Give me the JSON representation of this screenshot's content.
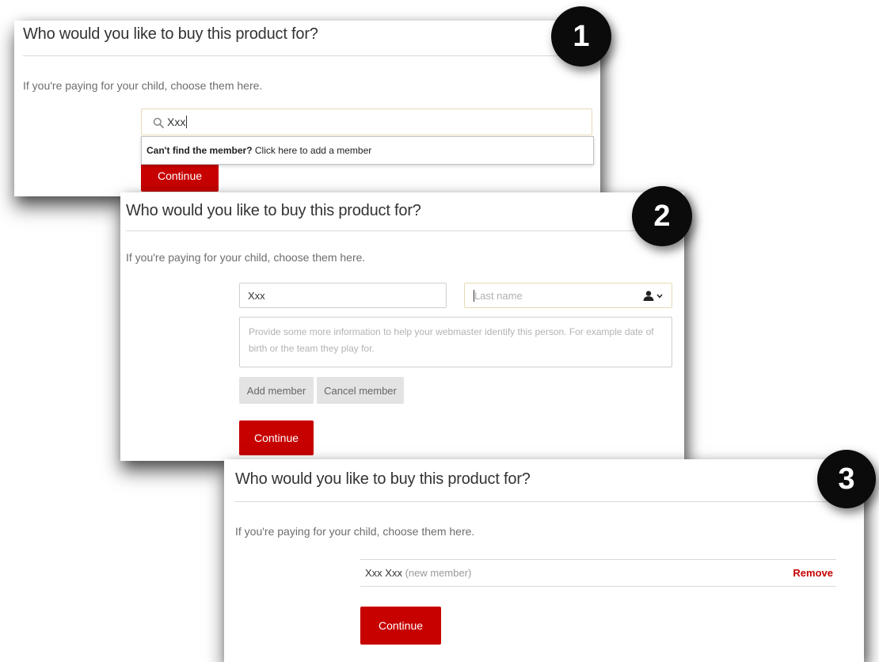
{
  "colors": {
    "accent": "#c70000",
    "badge": "#0b0b0b",
    "divider": "#d9d9d9",
    "muted_text": "#6d6d6d"
  },
  "step1": {
    "badge": "1",
    "title": "Who would you like to buy this product for?",
    "subtitle": "If you're paying for your child, choose them here.",
    "search": {
      "icon": "search-icon",
      "value": "Xxx"
    },
    "dropdown": {
      "bold_text": "Can't find the member?",
      "link_text": " Click here to add a member"
    },
    "continue_label": "Continue"
  },
  "step2": {
    "badge": "2",
    "title": "Who would you like to buy this product for?",
    "subtitle": "If you're paying for your child, choose them here.",
    "first_name_value": "Xxx",
    "last_name_placeholder": "Last name",
    "info_placeholder": "Provide some more information to help your webmaster identify this person. For example date of birth or the team they play for.",
    "add_member_label": "Add member",
    "cancel_member_label": "Cancel member",
    "continue_label": "Continue"
  },
  "step3": {
    "badge": "3",
    "title": "Who would you like to buy this product for?",
    "subtitle": "If you're paying for your child, choose them here.",
    "member_name": "Xxx Xxx",
    "member_note": " (new member)",
    "remove_label": "Remove",
    "continue_label": "Continue"
  }
}
